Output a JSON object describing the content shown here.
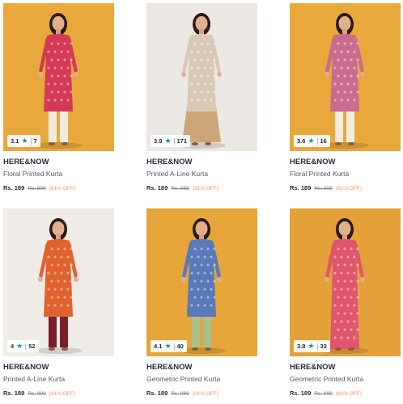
{
  "products": [
    {
      "rating": "3.1",
      "count": "7",
      "brand": "HERE&NOW",
      "title": "Floral Printed Kurta",
      "price": "Rs. 189",
      "mrp": "Rs. 999",
      "discount": "(81% OFF)",
      "bg": "#e8a83c",
      "outfit": "#d43a55",
      "bottoms": "#f0ebdf",
      "bottoms_type": "pants"
    },
    {
      "rating": "3.9",
      "count": "171",
      "brand": "HERE&NOW",
      "title": "Printed A-Line Kurta",
      "price": "Rs. 189",
      "mrp": "Rs. 999",
      "discount": "(81% OFF)",
      "bg": "#ece8e4",
      "outfit": "#d9c9b4",
      "bottoms": "#cba679",
      "bottoms_type": "palazzo"
    },
    {
      "rating": "3.6",
      "count": "16",
      "brand": "HERE&NOW",
      "title": "Floral Printed Kurta",
      "price": "Rs. 189",
      "mrp": "Rs. 999",
      "discount": "(81% OFF)",
      "bg": "#e8a83c",
      "outfit": "#c86b8e",
      "bottoms": "#f2ece0",
      "bottoms_type": "pants"
    },
    {
      "rating": "4",
      "count": "52",
      "brand": "HERE&NOW",
      "title": "Printed A-Line Kurta",
      "price": "Rs. 189",
      "mrp": "Rs. 999",
      "discount": "(81% OFF)",
      "bg": "#efebe7",
      "outfit": "#e0622e",
      "bottoms": "#7a1f2b",
      "bottoms_type": "pants"
    },
    {
      "rating": "4.1",
      "count": "40",
      "brand": "HERE&NOW",
      "title": "Geometric Printed Kurta",
      "price": "Rs. 189",
      "mrp": "Rs. 999",
      "discount": "(81% OFF)",
      "bg": "#e6a63a",
      "outfit": "#5a79b8",
      "bottoms": "#aac08a",
      "bottoms_type": "pants"
    },
    {
      "rating": "3.8",
      "count": "33",
      "brand": "HERE&NOW",
      "title": "Geometric Printed Kurta",
      "price": "Rs. 189",
      "mrp": "Rs. 999",
      "discount": "(81% OFF)",
      "bg": "#e4a13a",
      "outfit": "#e0566a",
      "bottoms": "#e0566a",
      "bottoms_type": "none"
    }
  ]
}
